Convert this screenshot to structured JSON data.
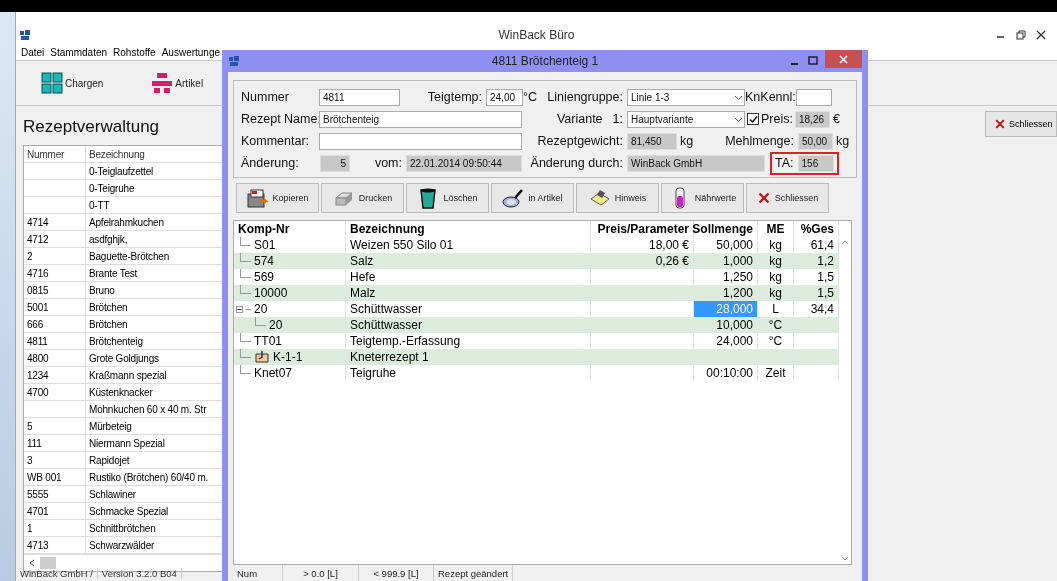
{
  "main_window": {
    "title": "WinBack Büro"
  },
  "menu": [
    "Datei",
    "Stammdaten",
    "Rohstoffe",
    "Auswertunge"
  ],
  "toolbar": [
    {
      "label": "Chargen",
      "kind": "batches"
    },
    {
      "label": "Artikel",
      "kind": "articles"
    }
  ],
  "heading": "Rezeptverwaltung",
  "recipe_list": {
    "columns": [
      "Nummer",
      "Bezeichnung"
    ],
    "rows": [
      {
        "bezeichnung": "0-Teiglaufzettel"
      },
      {
        "bezeichnung": "0-Teigruhe"
      },
      {
        "bezeichnung": "0-TT"
      },
      {
        "nummer": "4714",
        "bezeichnung": "Apfelrahmkuchen"
      },
      {
        "nummer": "4712",
        "bezeichnung": "asdfghjk,"
      },
      {
        "nummer": "2",
        "bezeichnung": "Baguette-Brötchen"
      },
      {
        "nummer": "4716",
        "bezeichnung": "Brante Test"
      },
      {
        "nummer": "0815",
        "bezeichnung": "Bruno"
      },
      {
        "nummer": "5001",
        "bezeichnung": "Brötchen"
      },
      {
        "nummer": "666",
        "bezeichnung": "Brötchen"
      },
      {
        "nummer": "4811",
        "bezeichnung": "Brötchenteig"
      },
      {
        "nummer": "4800",
        "bezeichnung": "Grote Goldjungs"
      },
      {
        "nummer": "1234",
        "bezeichnung": "Kraßmann spezial"
      },
      {
        "nummer": "4700",
        "bezeichnung": "Küstenknacker"
      },
      {
        "bezeichnung": "Mohnkuchen 60 x 40 m. Str"
      },
      {
        "nummer": "5",
        "bezeichnung": "Mürbeteig"
      },
      {
        "nummer": "111",
        "bezeichnung": "Niermann Spezial"
      },
      {
        "nummer": "3",
        "bezeichnung": "Rapidojet"
      },
      {
        "nummer": "WB 001",
        "bezeichnung": "Rustiko (Brötchen) 60/40 m."
      },
      {
        "nummer": "5555",
        "bezeichnung": "Schlawiner"
      },
      {
        "nummer": "4701",
        "bezeichnung": "Schmacke Spezial"
      },
      {
        "nummer": "1",
        "bezeichnung": "Schnittbrötchen"
      },
      {
        "nummer": "4713",
        "bezeichnung": "Schwarzwälder"
      }
    ]
  },
  "close_button": "Schliessen",
  "main_status_bar": [
    "WinBack GmbH /",
    "Version 3.2.0 B04"
  ],
  "dialog": {
    "title": "4811 Brötchenteig 1",
    "form": {
      "nummer": {
        "label": "Nummer",
        "value": "4811"
      },
      "teigtemp": {
        "label": "Teigtemp:",
        "value": "24,00",
        "unit": "°C"
      },
      "liniengruppe": {
        "label": "Liniengruppe:",
        "value": "Linie 1-3"
      },
      "knkennl": {
        "label": "KnKennl:"
      },
      "rezept_name": {
        "label": "Rezept Name:",
        "value": "Brötchenteig"
      },
      "variante": {
        "label": "Variante",
        "number": "1:",
        "value": "Hauptvariante"
      },
      "preis": {
        "label": "Preis:",
        "checked": true,
        "value": "18,26",
        "unit": "€"
      },
      "kommentar": {
        "label": "Kommentar:"
      },
      "rezeptgewicht": {
        "label": "Rezeptgewicht:",
        "value": "81,450",
        "unit": "kg"
      },
      "mehlmenge": {
        "label": "Mehlmenge:",
        "value": "50,00",
        "unit": "kg"
      },
      "aenderung": {
        "label": "Änderung:",
        "value": "5"
      },
      "vom": {
        "label": "vom:",
        "value": "22.01.2014 09:50:44"
      },
      "aenderung_durch": {
        "label": "Änderung durch:",
        "value": "WinBack GmbH"
      },
      "ta": {
        "label": "TA:",
        "value": "156",
        "highlighted": true
      }
    },
    "buttons": [
      {
        "label": "Kopieren",
        "kind": "copy"
      },
      {
        "label": "Drucken",
        "kind": "print"
      },
      {
        "label": "Löschen",
        "kind": "delete"
      },
      {
        "label": "in Artikel",
        "kind": "article"
      },
      {
        "label": "Hinweis",
        "kind": "note"
      },
      {
        "label": "Nährwerte",
        "kind": "nutrition"
      },
      {
        "label": "Schliessen",
        "kind": "close"
      }
    ],
    "table": {
      "columns": [
        "Komp-Nr",
        "Bezeichnung",
        "Preis/Parameter",
        "Sollmenge",
        "ME",
        "%Ges"
      ],
      "rows": [
        {
          "kind": "component",
          "komp_nr": "S01",
          "bezeichnung": "Weizen 550 Silo 01",
          "preis": "18,00 €",
          "sollmenge": "50,000",
          "me": "kg",
          "ges": "61,4",
          "selected": false
        },
        {
          "kind": "component",
          "komp_nr": "574",
          "bezeichnung": "Salz",
          "preis": "0,26 €",
          "sollmenge": "1,000",
          "me": "kg",
          "ges": "1,2",
          "selected": false
        },
        {
          "kind": "component",
          "komp_nr": "569",
          "bezeichnung": "Hefe",
          "sollmenge": "1,250",
          "me": "kg",
          "ges": "1,5",
          "selected": false
        },
        {
          "kind": "component",
          "komp_nr": "10000",
          "bezeichnung": "Malz",
          "sollmenge": "1,200",
          "me": "kg",
          "ges": "1,5",
          "selected": false
        },
        {
          "kind": "component",
          "komp_nr": "20",
          "bezeichnung": "Schüttwasser",
          "sollmenge": "28,000",
          "me": "L",
          "ges": "34,4",
          "selected": true,
          "expanded": true,
          "children": [
            {
              "kind": "component",
              "komp_nr": "20",
              "bezeichnung": "Schüttwasser",
              "sollmenge": "10,000",
              "me": "°C",
              "selected": false
            }
          ]
        },
        {
          "kind": "component",
          "komp_nr": "TT01",
          "bezeichnung": "Teigtemp.-Erfassung",
          "sollmenge": "24,000",
          "me": "°C",
          "selected": false
        },
        {
          "kind": "kneader",
          "komp_nr": "K-1-1",
          "bezeichnung": "Kneterrezept 1",
          "selected": false
        },
        {
          "kind": "component",
          "komp_nr": "Knet07",
          "bezeichnung": "Teigruhe",
          "sollmenge": "00:10:00",
          "me": "Zeit",
          "selected": false
        }
      ]
    },
    "status_bar": [
      "Num",
      "> 0.0 [L]",
      "< 999.9 [L]",
      "Rezept geändert"
    ]
  }
}
